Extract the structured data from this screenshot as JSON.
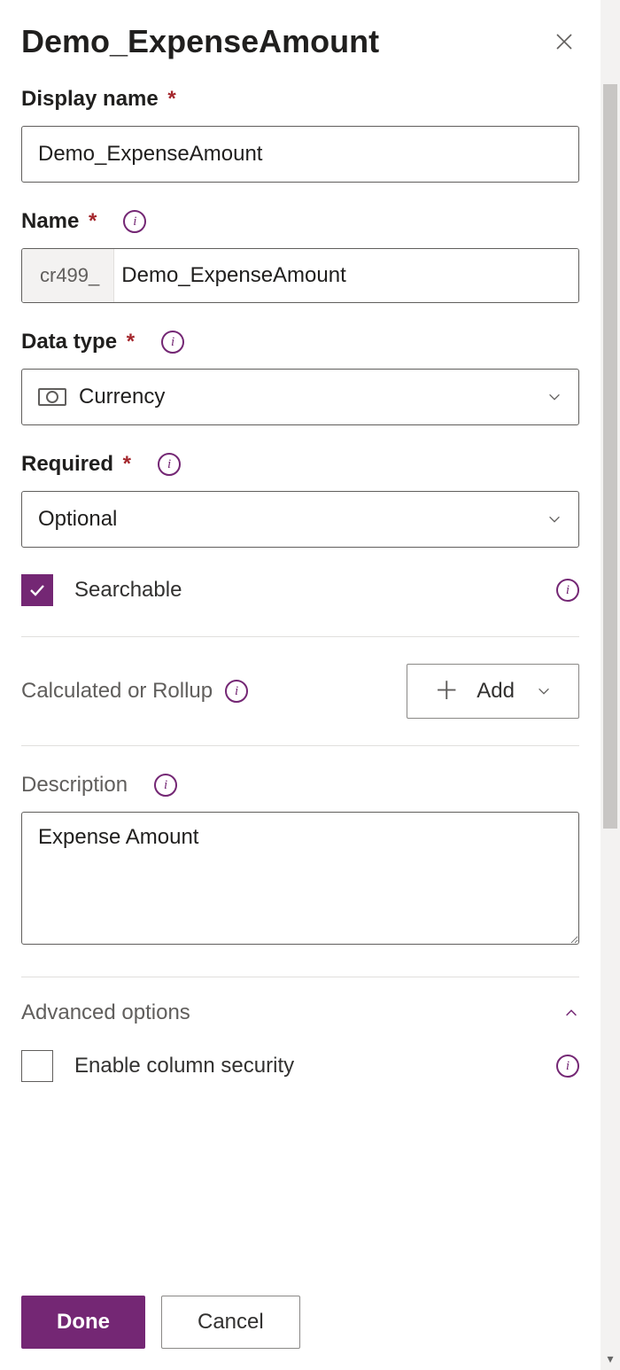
{
  "title": "Demo_ExpenseAmount",
  "displayName": {
    "label": "Display name",
    "value": "Demo_ExpenseAmount"
  },
  "name": {
    "label": "Name",
    "prefix": "cr499_",
    "value": "Demo_ExpenseAmount"
  },
  "dataType": {
    "label": "Data type",
    "value": "Currency"
  },
  "required": {
    "label": "Required",
    "value": "Optional"
  },
  "searchable": {
    "label": "Searchable",
    "checked": true
  },
  "calculated": {
    "label": "Calculated or Rollup",
    "addLabel": "Add"
  },
  "description": {
    "label": "Description",
    "value": "Expense Amount"
  },
  "advanced": {
    "label": "Advanced options"
  },
  "columnSecurity": {
    "label": "Enable column security",
    "checked": false
  },
  "footer": {
    "done": "Done",
    "cancel": "Cancel"
  }
}
